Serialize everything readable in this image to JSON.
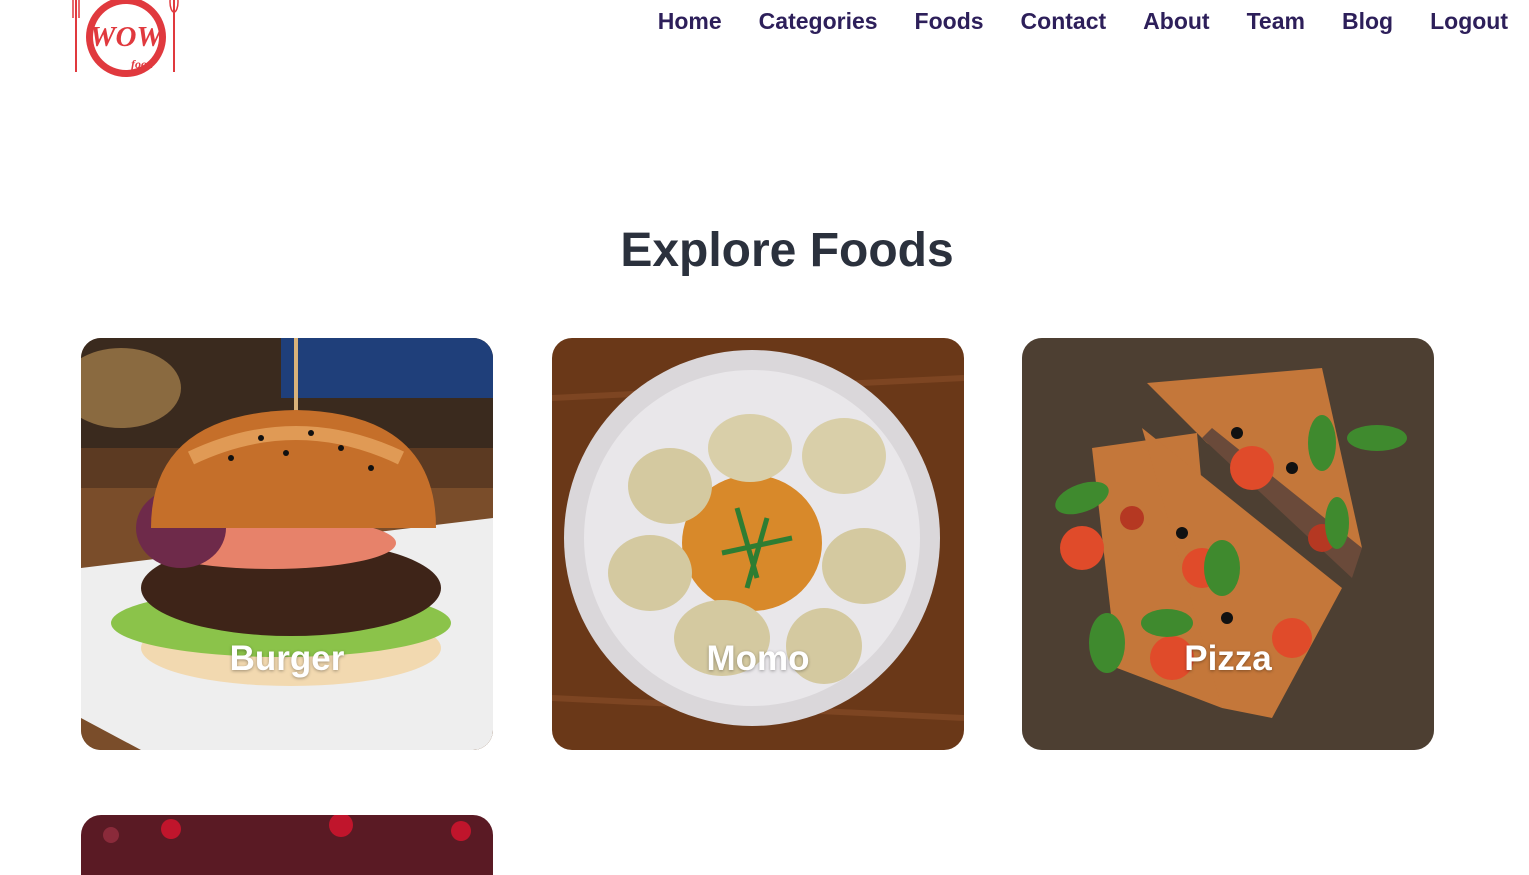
{
  "logo": {
    "text": "WOW",
    "subtext": "food",
    "color": "#e0393e"
  },
  "nav": {
    "items": [
      {
        "label": "Home"
      },
      {
        "label": "Categories"
      },
      {
        "label": "Foods"
      },
      {
        "label": "Contact"
      },
      {
        "label": "About"
      },
      {
        "label": "Team"
      },
      {
        "label": "Blog"
      },
      {
        "label": "Logout"
      }
    ],
    "color": "#2d1f5a"
  },
  "main": {
    "title": "Explore Foods",
    "foods": [
      {
        "name": "Burger"
      },
      {
        "name": "Momo"
      },
      {
        "name": "Pizza"
      }
    ]
  }
}
